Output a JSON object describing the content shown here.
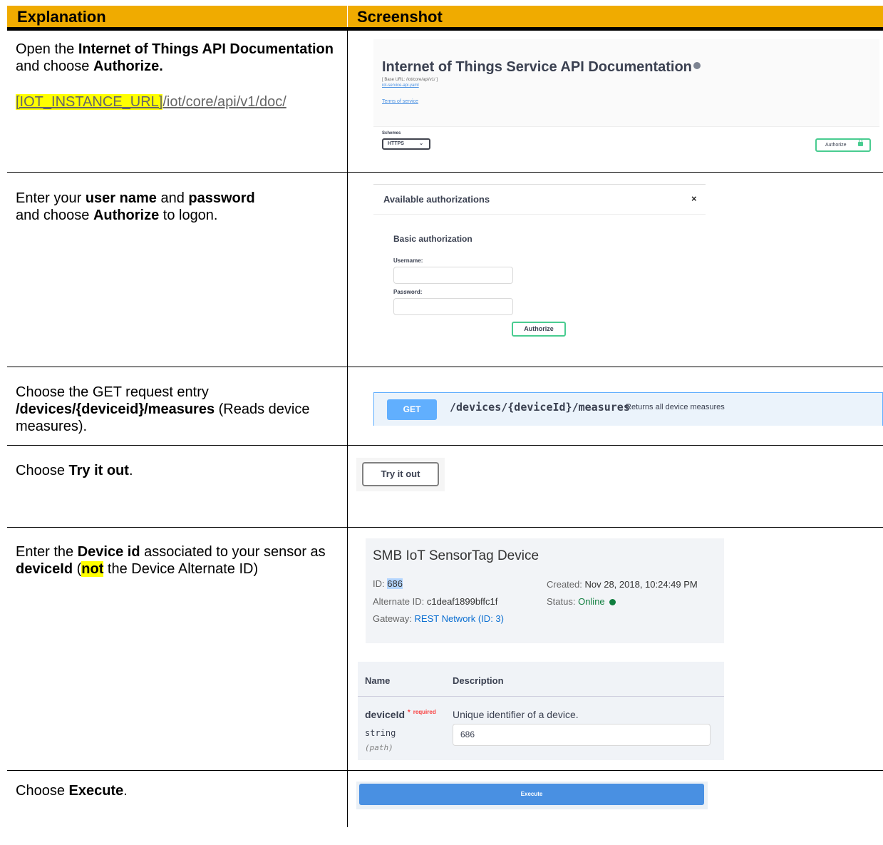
{
  "header": {
    "col1": "Explanation",
    "col2": "Screenshot"
  },
  "rows": [
    {
      "step": {
        "pre": "Open the ",
        "b1": "Internet of Things API Documentation",
        "mid": " and choose ",
        "b2": "Authorize.",
        "url_placeholder": "[IOT_INSTANCE_URL]",
        "url_path": "/iot/core/api/v1/doc/"
      },
      "shot": {
        "title": "Internet of Things Service API Documentation",
        "base_url": "[ Base URL: /iot/core/api/v1/ ]",
        "yaml_link": "iot-service-api.yaml",
        "terms": "Terms of service",
        "schemes_label": "Schemes",
        "scheme_value": "HTTPS",
        "authorize_label": "Authorize"
      }
    },
    {
      "step": {
        "pre": "Enter your ",
        "b1": "user name",
        "mid": " and ",
        "b2": "password",
        "mid2": " and choose ",
        "b3": "Authorize",
        "post": " to logon."
      },
      "shot": {
        "heading": "Available authorizations",
        "close": "×",
        "section": "Basic authorization",
        "username_label": "Username:",
        "password_label": "Password:",
        "authorize_label": "Authorize"
      }
    },
    {
      "step": {
        "pre": "Choose the GET request entry ",
        "b1": "/devices/{deviceid}/measures",
        "post": " (Reads device measures)."
      },
      "shot": {
        "method": "GET",
        "path": "/devices/{deviceId}/measures",
        "summary": "Returns all device measures"
      }
    },
    {
      "step": {
        "pre": "Choose ",
        "b1": "Try it out",
        "post": "."
      },
      "shot": {
        "button": "Try it out"
      }
    },
    {
      "step": {
        "pre": "Enter the ",
        "b1": "Device id",
        "mid": " associated to your sensor as ",
        "b2": "deviceId",
        "mid2": " (",
        "b3": "not",
        "post": " the Device Alternate ID)"
      },
      "shot": {
        "device_title": "SMB IoT SensorTag Device",
        "id_label": "ID: ",
        "id_value": "686",
        "alt_label": "Alternate ID: ",
        "alt_value": "c1deaf1899bffc1f",
        "gw_label": "Gateway: ",
        "gw_value": "REST Network (ID: 3)",
        "created_label": "Created: ",
        "created_value": "Nov 28, 2018, 10:24:49 PM",
        "status_label": "Status: ",
        "status_value": "Online",
        "col_name": "Name",
        "col_desc": "Description",
        "param_name": "deviceId",
        "param_star": "*",
        "param_required": "required",
        "param_desc": "Unique identifier of a device.",
        "param_type": "string",
        "param_in": "(path)",
        "param_value": "686"
      }
    },
    {
      "step": {
        "pre": "Choose ",
        "b1": "Execute",
        "post": "."
      },
      "shot": {
        "button": "Execute"
      }
    }
  ]
}
